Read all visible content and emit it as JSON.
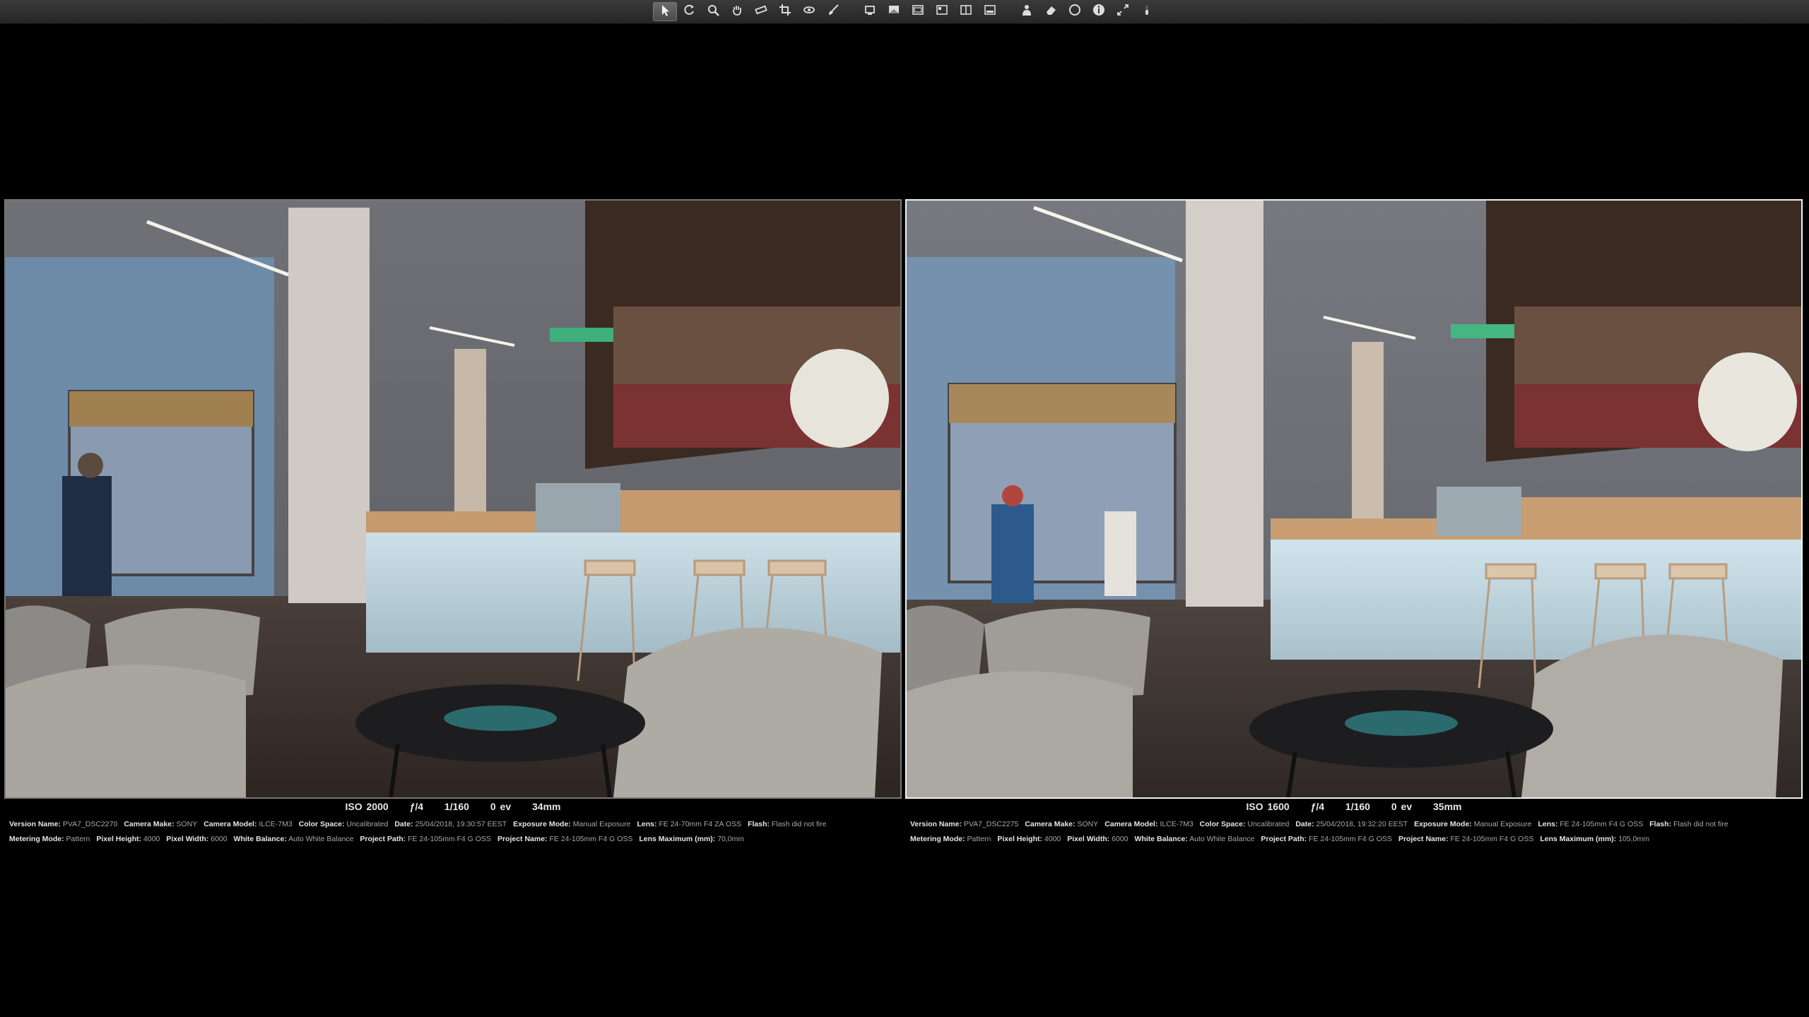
{
  "toolbar": {
    "tools": [
      {
        "name": "select-tool-icon",
        "active": true
      },
      {
        "name": "rotate-tool-icon"
      },
      {
        "name": "loupe-tool-icon"
      },
      {
        "name": "pan-tool-icon"
      },
      {
        "name": "straighten-tool-icon"
      },
      {
        "name": "crop-tool-icon"
      },
      {
        "name": "red-eye-tool-icon"
      },
      {
        "name": "brush-tool-icon"
      },
      {
        "name": "sep"
      },
      {
        "name": "view-single-icon"
      },
      {
        "name": "view-multi-icon"
      },
      {
        "name": "view-compare-icon"
      },
      {
        "name": "view-browser-icon"
      },
      {
        "name": "view-split-icon"
      },
      {
        "name": "view-filmstrip-icon"
      },
      {
        "name": "sep"
      },
      {
        "name": "person-icon"
      },
      {
        "name": "eraser-icon"
      },
      {
        "name": "circle-icon"
      },
      {
        "name": "info-icon"
      },
      {
        "name": "fullscreen-icon"
      },
      {
        "name": "slider-icon"
      }
    ]
  },
  "images": [
    {
      "summary": {
        "iso": "ISO 2000",
        "aperture": "ƒ/4",
        "shutter": "1/160",
        "ev": "0 ev",
        "focal": "34mm"
      },
      "line1": [
        {
          "k": "Version Name:",
          "v": "PVA7_DSC2270"
        },
        {
          "k": "Camera Make:",
          "v": "SONY"
        },
        {
          "k": "Camera Model:",
          "v": "ILCE-7M3"
        },
        {
          "k": "Color Space:",
          "v": "Uncalibrated"
        },
        {
          "k": "Date:",
          "v": "25/04/2018, 19:30:57 EEST"
        },
        {
          "k": "Exposure Mode:",
          "v": "Manual Exposure"
        },
        {
          "k": "Lens:",
          "v": "FE 24-70mm F4 ZA OSS"
        },
        {
          "k": "Flash:",
          "v": "Flash did not fire"
        }
      ],
      "line2": [
        {
          "k": "Metering Mode:",
          "v": "Pattern"
        },
        {
          "k": "Pixel Height:",
          "v": "4000"
        },
        {
          "k": "Pixel Width:",
          "v": "6000"
        },
        {
          "k": "White Balance:",
          "v": "Auto White Balance"
        },
        {
          "k": "Project Path:",
          "v": "FE 24-105mm F4 G OSS"
        },
        {
          "k": "Project Name:",
          "v": "FE 24-105mm F4 G OSS"
        },
        {
          "k": "Lens Maximum (mm):",
          "v": "70,0mm"
        }
      ]
    },
    {
      "summary": {
        "iso": "ISO 1600",
        "aperture": "ƒ/4",
        "shutter": "1/160",
        "ev": "0 ev",
        "focal": "35mm"
      },
      "line1": [
        {
          "k": "Version Name:",
          "v": "PVA7_DSC2275"
        },
        {
          "k": "Camera Make:",
          "v": "SONY"
        },
        {
          "k": "Camera Model:",
          "v": "ILCE-7M3"
        },
        {
          "k": "Color Space:",
          "v": "Uncalibrated"
        },
        {
          "k": "Date:",
          "v": "25/04/2018, 19:32:20 EEST"
        },
        {
          "k": "Exposure Mode:",
          "v": "Manual Exposure"
        },
        {
          "k": "Lens:",
          "v": "FE 24-105mm F4 G OSS"
        },
        {
          "k": "Flash:",
          "v": "Flash did not fire"
        }
      ],
      "line2": [
        {
          "k": "Metering Mode:",
          "v": "Pattern"
        },
        {
          "k": "Pixel Height:",
          "v": "4000"
        },
        {
          "k": "Pixel Width:",
          "v": "6000"
        },
        {
          "k": "White Balance:",
          "v": "Auto White Balance"
        },
        {
          "k": "Project Path:",
          "v": "FE 24-105mm F4 G OSS"
        },
        {
          "k": "Project Name:",
          "v": "FE 24-105mm F4 G OSS"
        },
        {
          "k": "Lens Maximum (mm):",
          "v": "105,0mm"
        }
      ]
    }
  ]
}
